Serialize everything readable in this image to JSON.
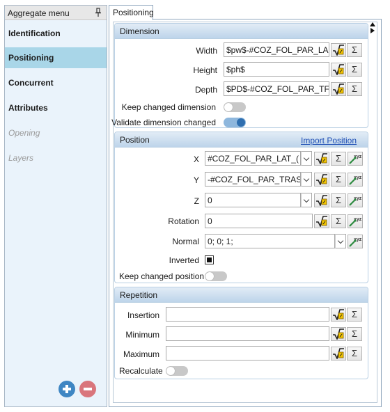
{
  "sidebar": {
    "title": "Aggregate menu",
    "items": [
      {
        "label": "Identification"
      },
      {
        "label": "Positioning"
      },
      {
        "label": "Concurrent"
      },
      {
        "label": "Attributes"
      },
      {
        "label": "Opening"
      },
      {
        "label": "Layers"
      }
    ],
    "add_color": "#3f86c3",
    "remove_color": "#d9757c"
  },
  "tab": {
    "label": "Positioning"
  },
  "dimension": {
    "title": "Dimension",
    "width_label": "Width",
    "width_value": "$pw$-#COZ_FOL_PAR_LA",
    "height_label": "Height",
    "height_value": "$ph$",
    "depth_label": "Depth",
    "depth_value": "$PD$-#COZ_FOL_PAR_TF",
    "keep_label": "Keep changed dimension",
    "keep_on": false,
    "validate_label": "Validate dimension changed",
    "validate_on": true
  },
  "position": {
    "title": "Position",
    "import_label": "Import Position",
    "x_label": "X",
    "x_value": "#COZ_FOL_PAR_LAT_(",
    "y_label": "Y",
    "y_value": "-#COZ_FOL_PAR_TRAS",
    "z_label": "Z",
    "z_value": "0",
    "rotation_label": "Rotation",
    "rotation_value": "0",
    "normal_label": "Normal",
    "normal_value": "0; 0; 1;",
    "inverted_label": "Inverted",
    "inverted_checked": true,
    "keep_label": "Keep changed position",
    "keep_on": false
  },
  "repetition": {
    "title": "Repetition",
    "insertion_label": "Insertion",
    "insertion_value": "",
    "minimum_label": "Minimum",
    "minimum_value": "",
    "maximum_label": "Maximum",
    "maximum_value": "",
    "recalculate_label": "Recalculate",
    "recalculate_on": false
  },
  "icons": {
    "formula": "formula-icon",
    "sum": "sigma-icon",
    "xyz": "xyz-pick-icon",
    "sum_glyph": "Σ"
  }
}
